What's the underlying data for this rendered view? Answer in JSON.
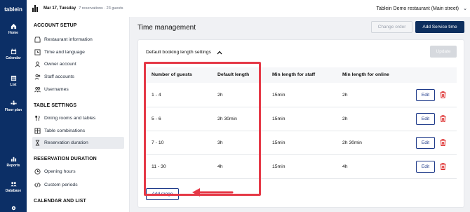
{
  "app": {
    "logo": "tablein"
  },
  "nav": [
    {
      "label": "Home",
      "icon": "home-icon"
    },
    {
      "label": "Calendar",
      "icon": "calendar-icon"
    },
    {
      "label": "List",
      "icon": "list-icon"
    },
    {
      "label": "Floor plan",
      "icon": "floor-plan-icon"
    },
    {
      "label": "Reports",
      "icon": "reports-icon"
    },
    {
      "label": "Database",
      "icon": "database-icon"
    }
  ],
  "topbar": {
    "date": "Mar 17, Tuesday",
    "summary": "7 reservations · 23 guests",
    "restaurant": "Tablein Demo restaurant (Main street)"
  },
  "sidebar": {
    "account_title": "ACCOUNT SETUP",
    "account_items": [
      "Restaurant information",
      "Time and language",
      "Owner account",
      "Staff accounts",
      "Usernames"
    ],
    "table_title": "TABLE SETTINGS",
    "table_items": [
      "Dining rooms and tables",
      "Table combinations",
      "Reservation duration"
    ],
    "duration_title": "RESERVATION DURATION",
    "duration_items": [
      "Opening hours",
      "Custom periods"
    ],
    "calendar_title": "CALENDAR AND LIST"
  },
  "main": {
    "title": "Time management",
    "change_order": "Change order",
    "add_service": "Add Service time",
    "panel_title": "Default booking length settings",
    "update": "Update",
    "headers": [
      "Number of guests",
      "Default length",
      "Min length for staff",
      "Min length for online"
    ],
    "rows": [
      {
        "guests": "1 - 4",
        "default": "2h",
        "staff": "15min",
        "online": "2h"
      },
      {
        "guests": "5 - 6",
        "default": "2h 30min",
        "staff": "15min",
        "online": "2h"
      },
      {
        "guests": "7 - 10",
        "default": "3h",
        "staff": "15min",
        "online": "2h 30min"
      },
      {
        "guests": "11 - 30",
        "default": "4h",
        "staff": "15min",
        "online": "4h"
      }
    ],
    "edit": "Edit",
    "add_range": "Add range"
  },
  "colors": {
    "nav_bg": "#0c2f66",
    "primary": "#0d2e5e",
    "highlight": "#e53947",
    "delete": "#dc2626"
  }
}
